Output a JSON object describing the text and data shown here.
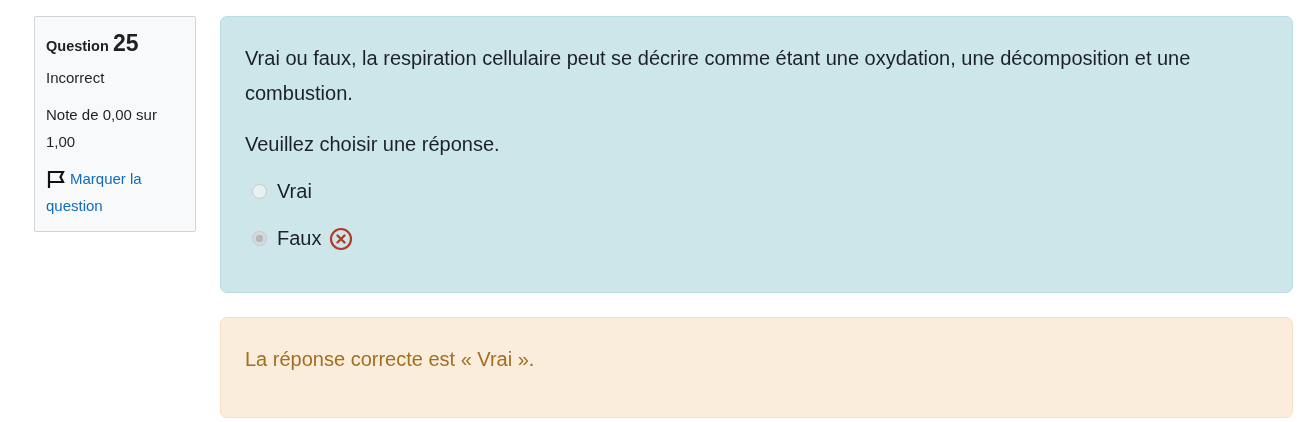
{
  "info": {
    "label": "Question",
    "number": "25",
    "state": "Incorrect",
    "grade": "Note de 0,00 sur 1,00",
    "flag_link": "Marquer la question",
    "flagged": false
  },
  "question": {
    "text": "Vrai ou faux, la respiration cellulaire peut se décrire comme étant une oxydation, une décomposition et une combustion.",
    "prompt": "Veuillez choisir une réponse.",
    "options": [
      {
        "label": "Vrai",
        "selected": false,
        "disabled": true,
        "marked_incorrect": false
      },
      {
        "label": "Faux",
        "selected": true,
        "disabled": true,
        "marked_incorrect": true
      }
    ]
  },
  "feedback": {
    "text": "La réponse correcte est « Vrai »."
  }
}
